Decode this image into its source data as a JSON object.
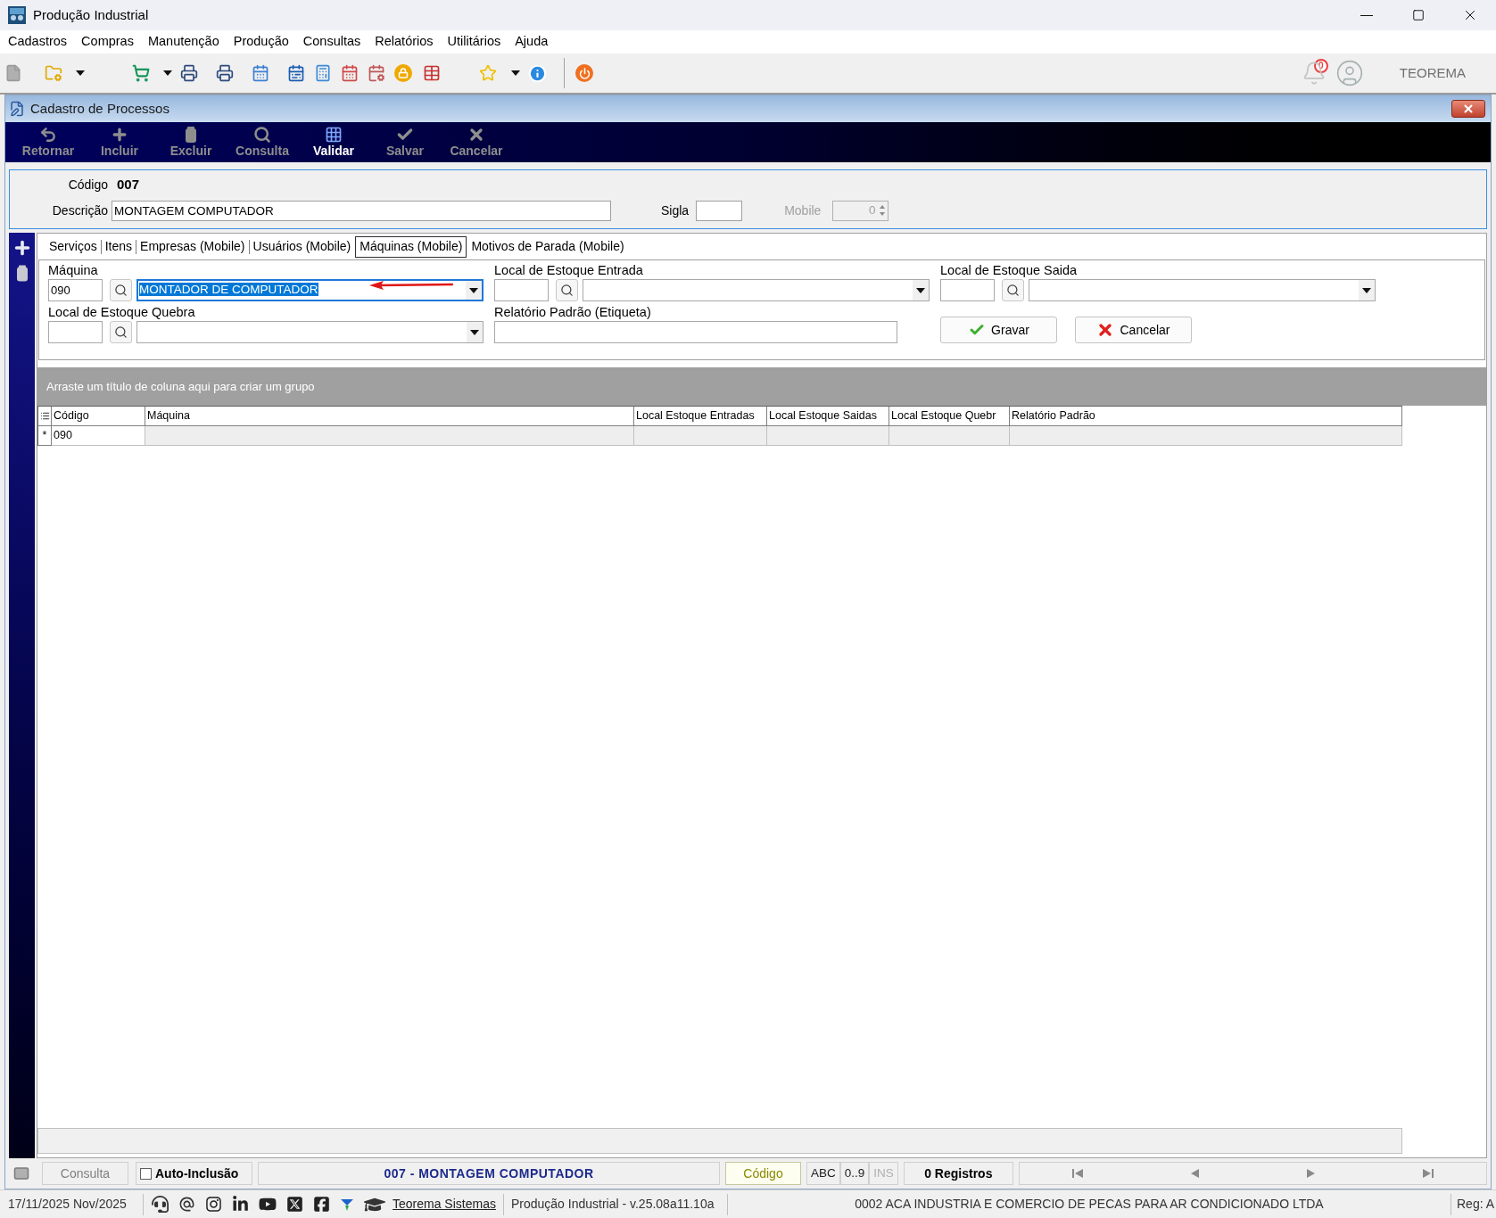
{
  "window": {
    "title": "Produção Industrial"
  },
  "menu": [
    "Cadastros",
    "Compras",
    "Manutenção",
    "Produção",
    "Consultas",
    "Relatórios",
    "Utilitários",
    "Ajuda"
  ],
  "toolbar": {
    "notifications": "0",
    "user": "TEOREMA"
  },
  "child_window": {
    "title": "Cadastro de Processos",
    "actions": [
      {
        "kind": "return",
        "label": "Retornar",
        "disabled": true
      },
      {
        "kind": "add",
        "label": "Incluir",
        "disabled": true
      },
      {
        "kind": "delete",
        "label": "Excluir",
        "disabled": true
      },
      {
        "kind": "search",
        "label": "Consulta",
        "disabled": true
      },
      {
        "kind": "validate",
        "label": "Validar",
        "disabled": false
      },
      {
        "kind": "save",
        "label": "Salvar",
        "disabled": true
      },
      {
        "kind": "cancel",
        "label": "Cancelar",
        "disabled": true
      }
    ]
  },
  "header": {
    "code": {
      "label": "Código",
      "value": "007"
    },
    "description": {
      "label": "Descrição",
      "value": "MONTAGEM COMPUTADOR"
    },
    "abbreviation": {
      "label": "Sigla"
    },
    "mobile": {
      "label": "Mobile",
      "value": "0",
      "disabled": true
    }
  },
  "tabs": [
    {
      "label": "Serviços",
      "selected": false
    },
    {
      "label": "Itens",
      "selected": false
    },
    {
      "label": "Empresas (Mobile)",
      "selected": false
    },
    {
      "label": "Usuários (Mobile)",
      "selected": false
    },
    {
      "label": "Máquinas (Mobile)",
      "selected": true
    },
    {
      "label": "Motivos de Parada (Mobile)",
      "selected": false
    }
  ],
  "form": {
    "lookups": [
      {
        "label": "Máquina",
        "code": "090",
        "name": "MONTADOR DE COMPUTADOR",
        "focused": true
      },
      {
        "label": "Local de Estoque Entrada",
        "focused": false
      },
      {
        "label": "Local de Estoque Saida",
        "focused": false
      },
      {
        "label": "Local de Estoque Quebra",
        "focused": false
      }
    ],
    "report": {
      "label": "Relatório Padrão (Etiqueta)"
    },
    "buttons": [
      {
        "kind": "confirm",
        "label": "Gravar"
      },
      {
        "kind": "cancel",
        "label": "Cancelar"
      }
    ]
  },
  "grid": {
    "group_hint": "Arraste um título de coluna aqui para criar um grupo",
    "columns": [
      "Código",
      "Máquina",
      "Local Estoque Entradas",
      "Local Estoque Saidas",
      "Local Estoque Quebr",
      "Relatório Padrão"
    ],
    "rows": [
      {
        "indicator": "*",
        "cells": [
          "090"
        ]
      }
    ]
  },
  "status_bar": {
    "mode": "Consulta",
    "auto_inclusion": {
      "label": "Auto-Inclusão",
      "checked": false
    },
    "record": "007 - MONTAGEM COMPUTADOR",
    "sort_field": "Código",
    "indicators": [
      {
        "label": "ABC",
        "disabled": false
      },
      {
        "label": "0..9",
        "disabled": false
      },
      {
        "label": "INS",
        "disabled": true
      }
    ],
    "count": "0 Registros"
  },
  "footer": {
    "date": "17/11/2025 Nov/2025",
    "link": "Teorema Sistemas",
    "version": "Produção Industrial - v.25.08a11.10a",
    "company": "0002 ACA INDUSTRIA E COMERCIO DE PECAS PARA AR CONDICIONADO LTDA",
    "reg": "Reg: A"
  }
}
